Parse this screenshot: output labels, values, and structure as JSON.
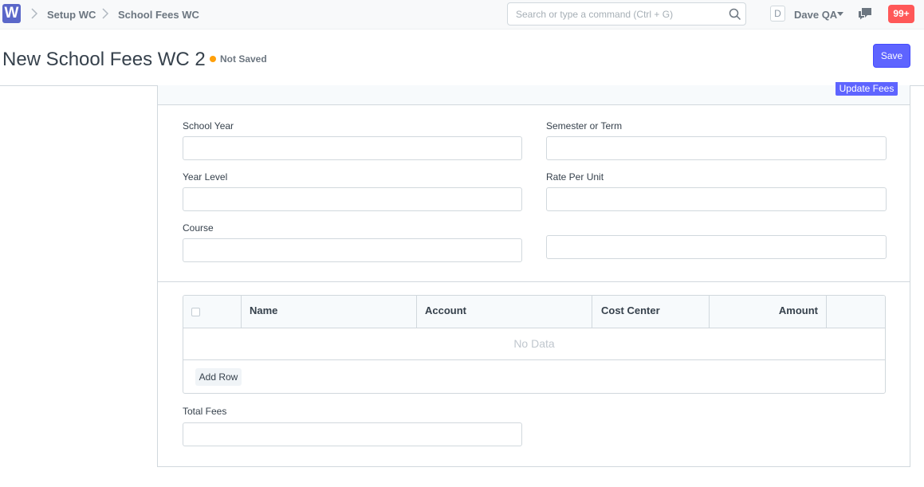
{
  "navbar": {
    "logo_letter": "W",
    "breadcrumbs": [
      "Setup WC",
      "School Fees WC"
    ],
    "search_placeholder": "Search or type a command (Ctrl + G)",
    "avatar_letter": "D",
    "user_name": "Dave QA",
    "notification_count": "99+"
  },
  "page": {
    "title": "New School Fees WC 2",
    "status": "Not Saved",
    "save_label": "Save"
  },
  "form": {
    "update_fees_label": "Update Fees",
    "fields": {
      "school_year": {
        "label": "School Year",
        "value": ""
      },
      "semester": {
        "label": "Semester or Term",
        "value": ""
      },
      "year_level": {
        "label": "Year Level",
        "value": ""
      },
      "rate_per_unit": {
        "label": "Rate Per Unit",
        "value": ""
      },
      "course": {
        "label": "Course",
        "value": ""
      },
      "unlabeled": {
        "value": ""
      },
      "total_fees": {
        "label": "Total Fees",
        "value": ""
      }
    },
    "grid": {
      "columns": [
        "Name",
        "Account",
        "Cost Center",
        "Amount"
      ],
      "empty_text": "No Data",
      "add_row_label": "Add Row"
    }
  },
  "colors": {
    "primary": "#5e64ff",
    "status_not_saved": "#ffa00a",
    "notification": "#ff5858",
    "logo": "#5a67c9"
  }
}
